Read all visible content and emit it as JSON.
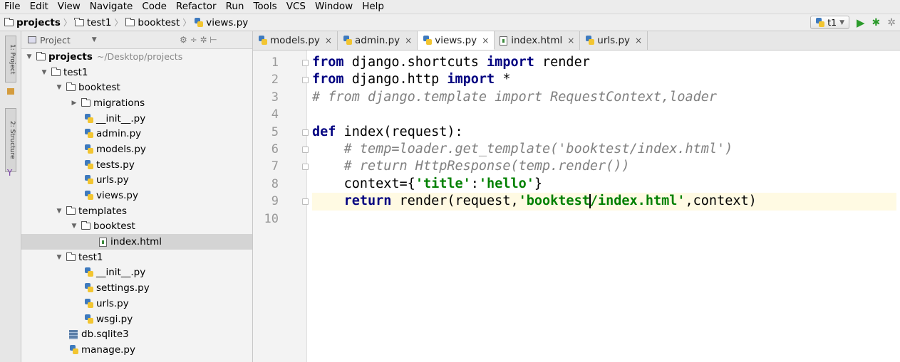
{
  "menu": [
    "File",
    "Edit",
    "View",
    "Navigate",
    "Code",
    "Refactor",
    "Run",
    "Tools",
    "VCS",
    "Window",
    "Help"
  ],
  "breadcrumb": {
    "root": "projects",
    "sub1": "test1",
    "sub2": "booktest",
    "file": "views.py"
  },
  "run": {
    "config": "t1"
  },
  "left_strip": {
    "tab1": "1: Project",
    "tab2": "2: Structure"
  },
  "panel": {
    "title": "Project",
    "tools": "⚙ ÷ ✲ ⊢"
  },
  "tree": [
    {
      "name": "projects",
      "sub": "~/Desktop/projects",
      "type": "folder",
      "arrow": "▼",
      "indent": 0,
      "bold": true
    },
    {
      "name": "test1",
      "type": "folder",
      "arrow": "▼",
      "indent": 1
    },
    {
      "name": "booktest",
      "type": "folder",
      "arrow": "▼",
      "indent": 2
    },
    {
      "name": "migrations",
      "type": "folder",
      "arrow": "▶",
      "indent": 3
    },
    {
      "name": "__init__.py",
      "type": "py",
      "indent": 4
    },
    {
      "name": "admin.py",
      "type": "py",
      "indent": 4
    },
    {
      "name": "models.py",
      "type": "py",
      "indent": 4
    },
    {
      "name": "tests.py",
      "type": "py",
      "indent": 4
    },
    {
      "name": "urls.py",
      "type": "py",
      "indent": 4
    },
    {
      "name": "views.py",
      "type": "py",
      "indent": 4
    },
    {
      "name": "templates",
      "type": "folder",
      "arrow": "▼",
      "indent": 2
    },
    {
      "name": "booktest",
      "type": "folder",
      "arrow": "▼",
      "indent": 3
    },
    {
      "name": "index.html",
      "type": "html",
      "indent": 5,
      "selected": true
    },
    {
      "name": "test1",
      "type": "folder",
      "arrow": "▼",
      "indent": 2
    },
    {
      "name": "__init__.py",
      "type": "py",
      "indent": 4
    },
    {
      "name": "settings.py",
      "type": "py",
      "indent": 4
    },
    {
      "name": "urls.py",
      "type": "py",
      "indent": 4
    },
    {
      "name": "wsgi.py",
      "type": "py",
      "indent": 4
    },
    {
      "name": "db.sqlite3",
      "type": "db",
      "indent": 3
    },
    {
      "name": "manage.py",
      "type": "py",
      "indent": 3
    }
  ],
  "tabs": [
    {
      "label": "models.py",
      "type": "py"
    },
    {
      "label": "admin.py",
      "type": "py"
    },
    {
      "label": "views.py",
      "type": "py",
      "active": true
    },
    {
      "label": "index.html",
      "type": "html"
    },
    {
      "label": "urls.py",
      "type": "py"
    }
  ],
  "tab_close": "×",
  "line_numbers": [
    "1",
    "2",
    "3",
    "4",
    "5",
    "6",
    "7",
    "8",
    "9",
    "10"
  ],
  "code": {
    "l1": {
      "kw1": "from",
      "t1": " django.shortcuts ",
      "kw2": "import",
      "t2": " render"
    },
    "l2": {
      "kw1": "from",
      "t1": " django.http ",
      "kw2": "import",
      "t2": " *"
    },
    "l3": "# from django.template import RequestContext,loader",
    "l5": {
      "kw": "def",
      "t": " index(request):"
    },
    "l6": "# temp=loader.get_template('booktest/index.html')",
    "l7": "# return HttpResponse(temp.render())",
    "l8": {
      "t1": "context={",
      "s1": "'title'",
      "t2": ":",
      "s2": "'hello'",
      "t3": "}"
    },
    "l9": {
      "kw": "return",
      "t1": " render(request,",
      "s1a": "'booktest",
      "s1b": "/index.html'",
      "t2": ",context)"
    }
  },
  "colors": {
    "keyword": "#000080",
    "string": "#008000",
    "comment": "#808080",
    "current_line": "#fffae3"
  }
}
